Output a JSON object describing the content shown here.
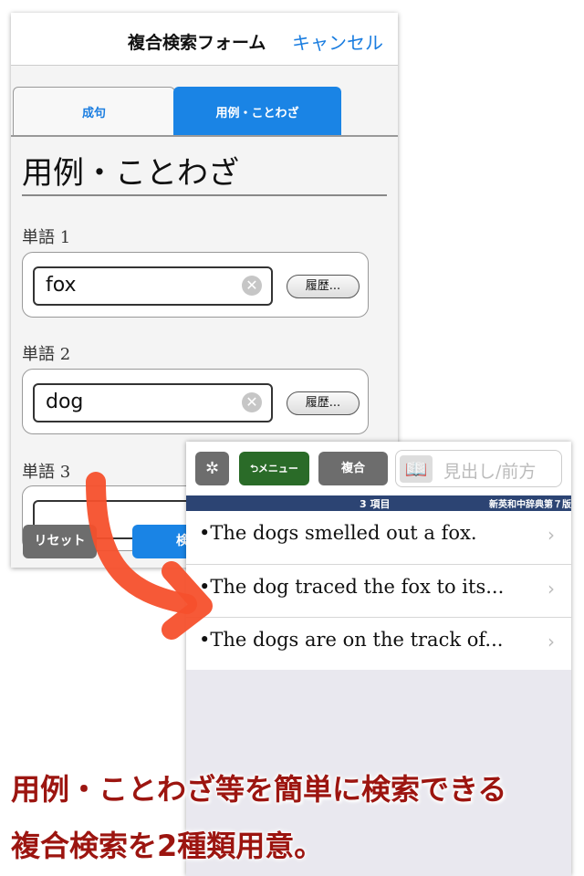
{
  "back_panel": {
    "title": "複合検索フォーム",
    "cancel": "キャンセル",
    "tabs": [
      {
        "label": "成句",
        "active": false
      },
      {
        "label": "用例・ことわざ",
        "active": true
      }
    ],
    "heading": "用例・ことわざ",
    "fields": [
      {
        "label": "単語 1",
        "value": "fox",
        "history": "履歴..."
      },
      {
        "label": "単語 2",
        "value": "dog",
        "history": "履歴..."
      },
      {
        "label": "単語 3",
        "value": ""
      }
    ],
    "reset": "リセット",
    "search": "検"
  },
  "front_panel": {
    "settings_icon": "gear-icon",
    "menu": "⮌メニュー",
    "combined": "複合",
    "search_placeholder": "見出し/前方",
    "book_icon": "book-icon",
    "count": "3 項目",
    "dictionary": "新英和中辞典第７版",
    "results": [
      "•The dogs smelled out a fox.",
      "•The dog traced the fox to its...",
      "•The dogs are on the track of..."
    ]
  },
  "caption": {
    "line1": "用例・ことわざ等を簡単に検索できる",
    "line2": "複合検索を2種類用意。"
  },
  "colors": {
    "accent": "#1a84e5",
    "arrow": "#f5502c",
    "caption": "#9c1510",
    "menu_green": "#2a6b28",
    "bar": "#2c4473"
  }
}
